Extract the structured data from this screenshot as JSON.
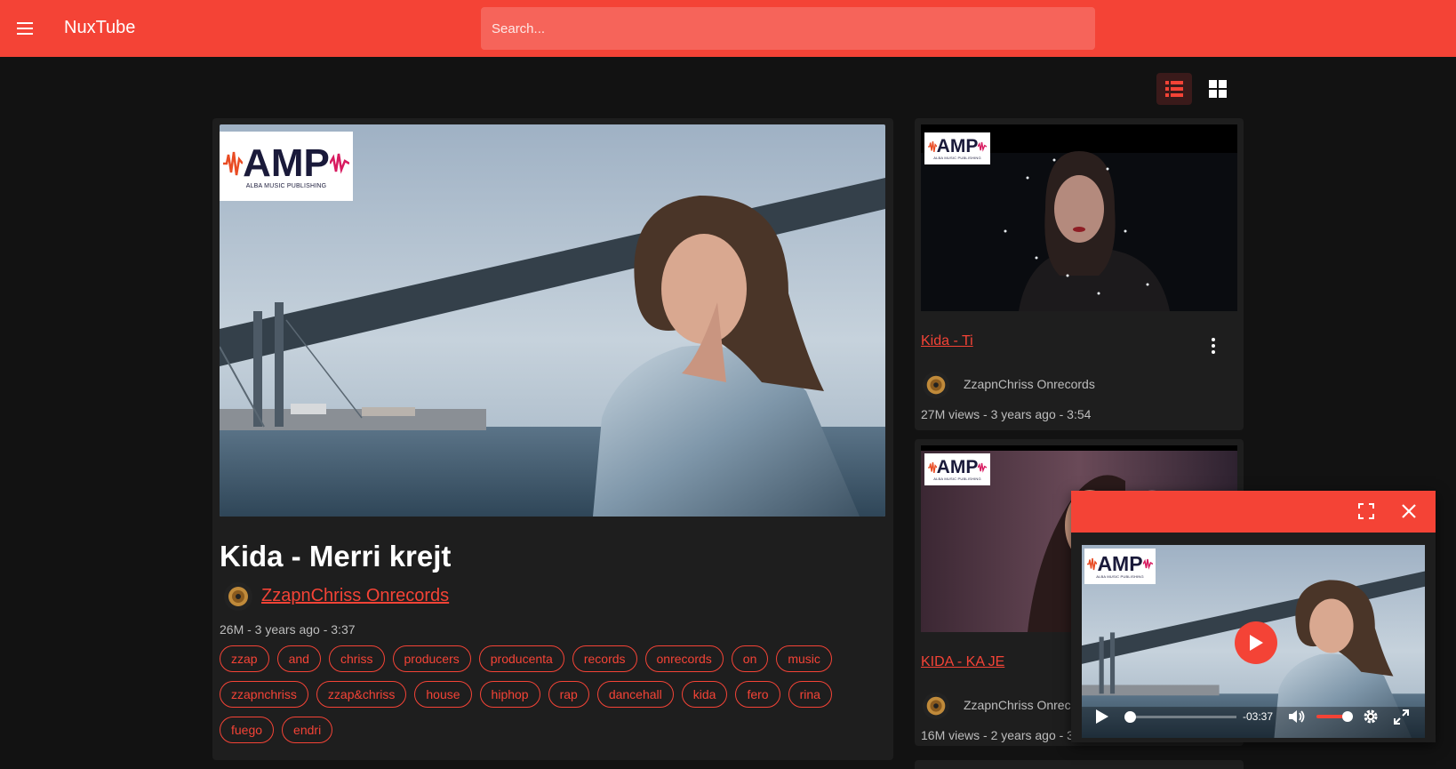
{
  "app": {
    "title": "NuxTube",
    "search_placeholder": "Search..."
  },
  "view_toggle": {
    "list_icon": "view-list-icon",
    "grid_icon": "view-grid-icon",
    "active": "list"
  },
  "main_video": {
    "title": "Kida - Merri krejt",
    "channel": "ZzapnChriss Onrecords",
    "meta": "26M - 3 years ago - 3:37",
    "logo_text": "AMP",
    "logo_subtext": "ALBA MUSIC PUBLISHING",
    "tags": [
      "zzap",
      "and",
      "chriss",
      "producers",
      "producenta",
      "records",
      "onrecords",
      "on",
      "music",
      "zzapnchriss",
      "zzap&chriss",
      "house",
      "hiphop",
      "rap",
      "dancehall",
      "kida",
      "fero",
      "rina",
      "fuego",
      "endri"
    ]
  },
  "side_videos": [
    {
      "title": "Kida - Ti",
      "channel": "ZzapnChriss Onrecords",
      "meta": "27M views - 3 years ago - 3:54"
    },
    {
      "title": "KIDA - KA JE",
      "channel": "ZzapnChriss Onrecords",
      "meta": "16M views - 2 years ago - 3"
    }
  ],
  "mini_player": {
    "time_remaining": "-03:37",
    "progress": 0,
    "volume": 0.75
  },
  "colors": {
    "accent": "#f44336",
    "background": "#121212",
    "card": "#1e1e1e"
  }
}
